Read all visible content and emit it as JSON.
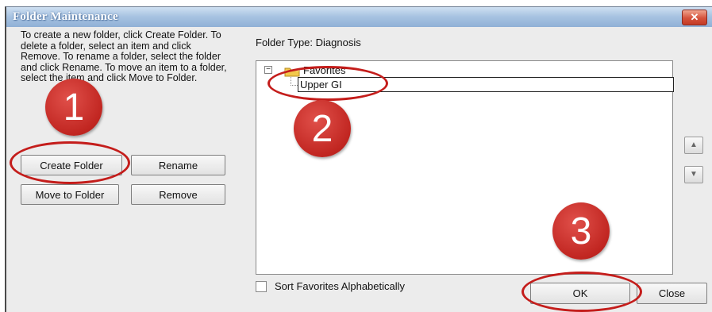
{
  "window": {
    "title": "Folder Maintenance",
    "close_glyph": "✕"
  },
  "instructions": "To create a new folder, click Create Folder. To delete a folder, select an item and click Remove. To rename a folder, select the folder and click Rename. To move an item to a folder, select the item and click Move to Folder.",
  "buttons": {
    "create_folder": "Create Folder",
    "rename": "Rename",
    "move_to_folder": "Move to Folder",
    "remove": "Remove",
    "ok": "OK",
    "close": "Close"
  },
  "folder_type": {
    "label": "Folder Type:",
    "value": "Diagnosis"
  },
  "tree": {
    "expander": "−",
    "root_label": "Favorites",
    "editing_value": "Upper GI"
  },
  "scroll": {
    "up_glyph": "▲",
    "down_glyph": "▼"
  },
  "sort_checkbox": {
    "label": "Sort Favorites Alphabetically",
    "checked": false
  },
  "annotations": {
    "step1": "1",
    "step2": "2",
    "step3": "3",
    "color": "#c41d1b"
  }
}
